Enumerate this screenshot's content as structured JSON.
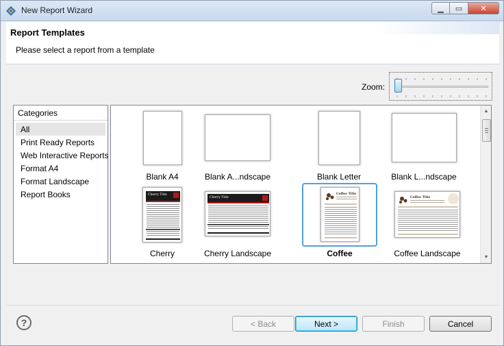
{
  "window": {
    "title": "New Report Wizard"
  },
  "header": {
    "title": "Report Templates",
    "subtitle": "Please select a report from a template"
  },
  "zoom": {
    "label": "Zoom:",
    "value_fraction": 0.0
  },
  "categories": {
    "header": "Categories",
    "items": [
      {
        "label": "All",
        "selected": true
      },
      {
        "label": "Print Ready Reports"
      },
      {
        "label": "Web Interactive Reports"
      },
      {
        "label": "Format A4"
      },
      {
        "label": "Format Landscape"
      },
      {
        "label": "Report Books"
      }
    ]
  },
  "templates": [
    {
      "label": "Blank A4"
    },
    {
      "label": "Blank A...ndscape"
    },
    {
      "label": "Blank Letter"
    },
    {
      "label": "Blank L...ndscape"
    },
    {
      "label": "Cherry",
      "thumb_title": "Cherry Title"
    },
    {
      "label": "Cherry Landscape",
      "thumb_title": "Cherry Title"
    },
    {
      "label": "Coffee",
      "thumb_title": "Coffee Title",
      "selected": true
    },
    {
      "label": "Coffee Landscape",
      "thumb_title": "Coffee Title"
    }
  ],
  "buttons": {
    "back": "< Back",
    "next": "Next >",
    "finish": "Finish",
    "cancel": "Cancel"
  },
  "icons": {
    "app": "eclipse-wizard-icon",
    "help": "help-icon",
    "minimize": "minimize-icon",
    "maximize": "maximize-icon",
    "close": "close-icon"
  },
  "help_glyph": "?",
  "colors": {
    "selection": "#4f9fdf",
    "cherry_accent": "#b01a1a",
    "coffee_accent": "#5a3a24"
  }
}
